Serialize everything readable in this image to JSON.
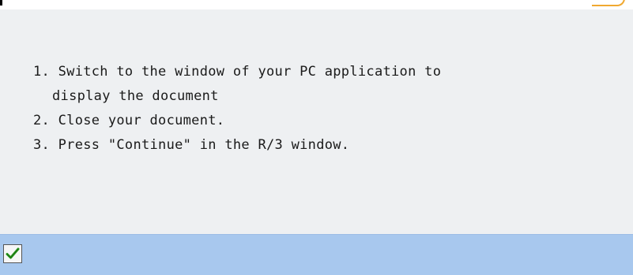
{
  "instructions": {
    "step1_num": "1.",
    "step1_line1": "Switch to the window of your PC application to",
    "step1_line2": "display the document",
    "step2_num": "2.",
    "step2_text": "Close your document.",
    "step3_num": "3.",
    "step3_text": "Press \"Continue\" in the R/3 window."
  },
  "footer": {
    "continue_icon": "check-icon"
  },
  "colors": {
    "background": "#eef0f2",
    "footer_bar": "#a8c8ee",
    "accent_border": "#f0a830",
    "check_green": "#2a9a1e"
  }
}
